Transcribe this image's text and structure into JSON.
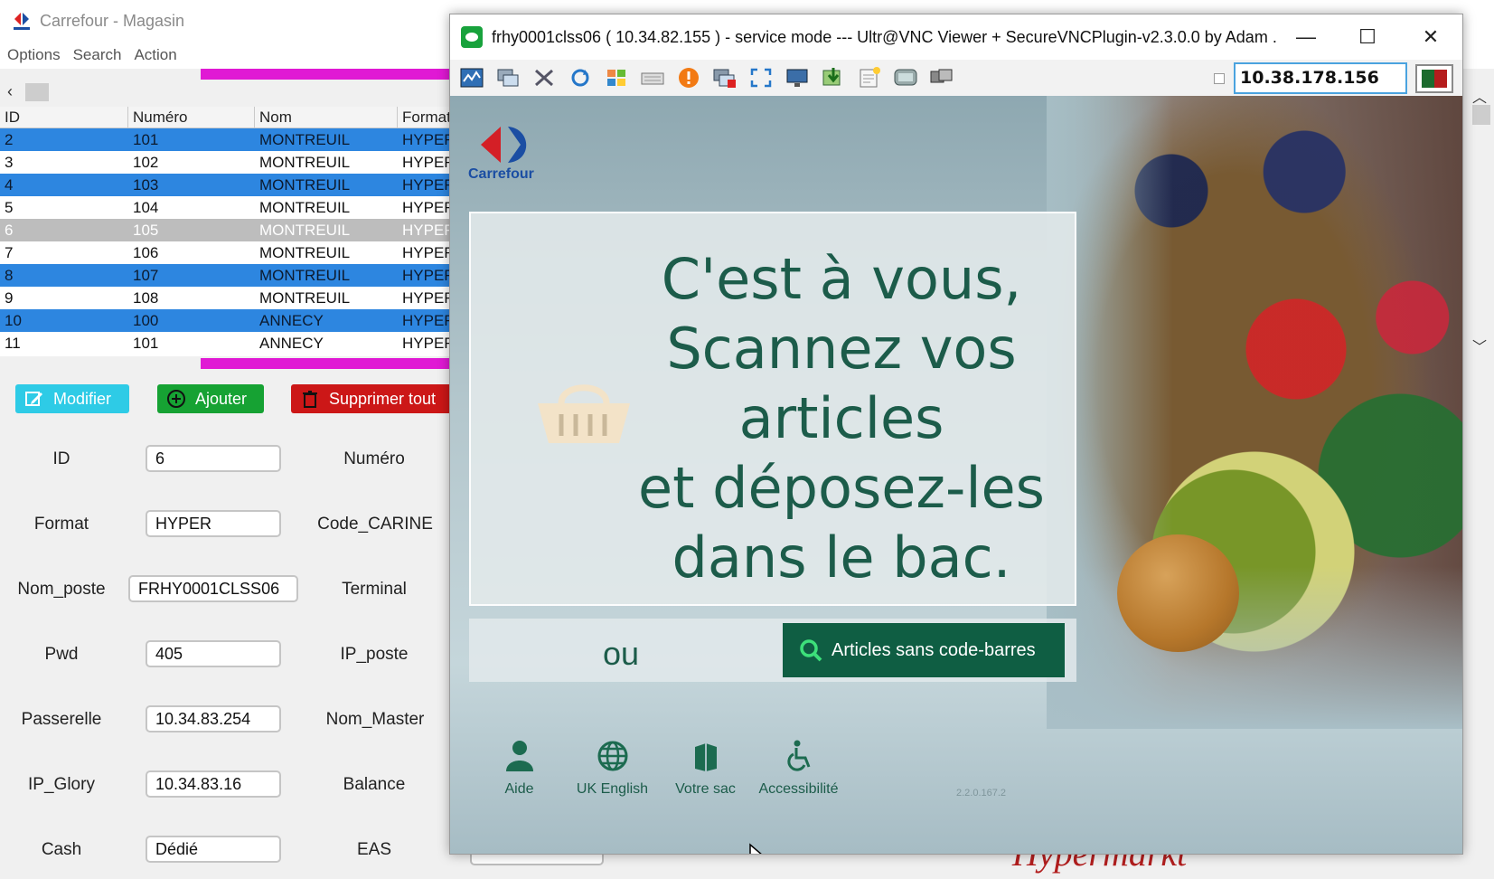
{
  "background_app": {
    "title": "Carrefour - Magasin",
    "menu": [
      "Options",
      "Search",
      "Action"
    ],
    "grid": {
      "columns": [
        "ID",
        "Numéro",
        "Nom",
        "Format"
      ],
      "rows": [
        {
          "id": "2",
          "numero": "101",
          "nom": "MONTREUIL",
          "format": "HYPER",
          "state": "selected"
        },
        {
          "id": "3",
          "numero": "102",
          "nom": "MONTREUIL",
          "format": "HYPER",
          "state": "plain"
        },
        {
          "id": "4",
          "numero": "103",
          "nom": "MONTREUIL",
          "format": "HYPER",
          "state": "selected"
        },
        {
          "id": "5",
          "numero": "104",
          "nom": "MONTREUIL",
          "format": "HYPER",
          "state": "plain"
        },
        {
          "id": "6",
          "numero": "105",
          "nom": "MONTREUIL",
          "format": "HYPER",
          "state": "current"
        },
        {
          "id": "7",
          "numero": "106",
          "nom": "MONTREUIL",
          "format": "HYPER",
          "state": "plain"
        },
        {
          "id": "8",
          "numero": "107",
          "nom": "MONTREUIL",
          "format": "HYPER",
          "state": "selected"
        },
        {
          "id": "9",
          "numero": "108",
          "nom": "MONTREUIL",
          "format": "HYPER",
          "state": "plain"
        },
        {
          "id": "10",
          "numero": "100",
          "nom": "ANNECY",
          "format": "HYPER",
          "state": "selected"
        },
        {
          "id": "11",
          "numero": "101",
          "nom": "ANNECY",
          "format": "HYPER",
          "state": "plain"
        }
      ]
    },
    "buttons": {
      "modify": "Modifier",
      "add": "Ajouter",
      "delete_all": "Supprimer tout"
    },
    "form": {
      "id": {
        "label": "ID",
        "value": "6"
      },
      "format": {
        "label": "Format",
        "value": "HYPER"
      },
      "nom_poste": {
        "label": "Nom_poste",
        "value": "FRHY0001CLSS06"
      },
      "pwd": {
        "label": "Pwd",
        "value": "405"
      },
      "passerelle": {
        "label": "Passerelle",
        "value": "10.34.83.254"
      },
      "ip_glory": {
        "label": "IP_Glory",
        "value": "10.34.83.16"
      },
      "cash": {
        "label": "Cash",
        "value": "Dédié"
      },
      "numero": {
        "label": "Numéro"
      },
      "code_carine": {
        "label": "Code_CARINE"
      },
      "terminal": {
        "label": "Terminal"
      },
      "ip_poste": {
        "label": "IP_poste"
      },
      "nom_master": {
        "label": "Nom_Master"
      },
      "balance": {
        "label": "Balance"
      },
      "eas": {
        "label": "EAS"
      }
    },
    "background_text": "Hypermarkt"
  },
  "vnc_window": {
    "title": "frhy0001clss06 ( 10.34.82.155 ) - service mode --- Ultr@VNC Viewer + SecureVNCPlugin-v2.3.0.0 by Adam ...",
    "ip_field": "10.38.178.156",
    "toolbar_icons": [
      "stats-icon",
      "windows-icon",
      "tools-icon",
      "refresh-icon",
      "start-icon",
      "keyboard-icon",
      "alert-icon",
      "close-session-icon",
      "fullscreen-icon",
      "monitor-icon",
      "transfer-icon",
      "notes-icon",
      "chat-icon",
      "screens-icon"
    ]
  },
  "kiosk": {
    "brand": "Carrefour",
    "message_lines": [
      "C'est à vous,",
      "Scannez vos",
      "articles",
      "et déposez-les",
      "dans le bac."
    ],
    "or_label": "ou",
    "no_barcode_button": "Articles sans code-barres",
    "bottom_items": [
      {
        "icon": "help-person-icon",
        "label": "Aide"
      },
      {
        "icon": "globe-icon",
        "label": "UK English"
      },
      {
        "icon": "bag-icon",
        "label": "Votre sac"
      },
      {
        "icon": "accessibility-icon",
        "label": "Accessibilité"
      }
    ],
    "version": "2.2.0.167.2"
  },
  "colors": {
    "selection_blue": "#2d86e0",
    "magenta": "#e019d4",
    "kiosk_green": "#0f5e43",
    "text_green": "#1c5c4a"
  }
}
